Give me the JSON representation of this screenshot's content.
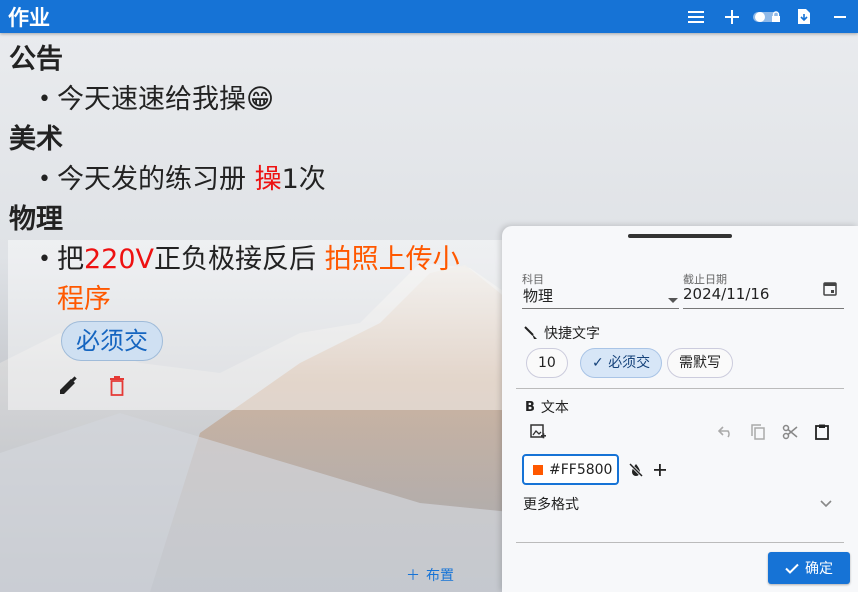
{
  "app": {
    "title": "作业"
  },
  "toolbar": {
    "icons": [
      "menu-icon",
      "add-icon",
      "lock-toggle-icon",
      "export-file-icon",
      "minimize-icon"
    ]
  },
  "homework": {
    "sections": [
      {
        "subject": "公告",
        "item_text": "今天速速给我操",
        "emoji": "😁"
      },
      {
        "subject": "美术",
        "item_prefix": "今天发的练习册 ",
        "item_highlight": "操",
        "item_suffix": "1次"
      },
      {
        "subject": "物理",
        "item_prefix": "把",
        "item_highlight_red": "220V",
        "item_middle": "正负极接反后 ",
        "item_highlight_orange": "拍照上传小",
        "item_line2": "程序",
        "tag": "必须交"
      }
    ],
    "layout_label": "布置"
  },
  "editor": {
    "subject_label": "科目",
    "subject_value": "物理",
    "due_label": "截止日期",
    "due_value": "2024/11/16",
    "quick_text_label": "快捷文字",
    "quick_chips": [
      "10",
      "必须交",
      "需默写"
    ],
    "text_label": "文本",
    "color_value": "#FF5800",
    "more_format_label": "更多格式",
    "confirm_label": "确定"
  },
  "colors": {
    "accent": "#1673d6",
    "orange": "#ff5800",
    "red": "#ee1111"
  }
}
